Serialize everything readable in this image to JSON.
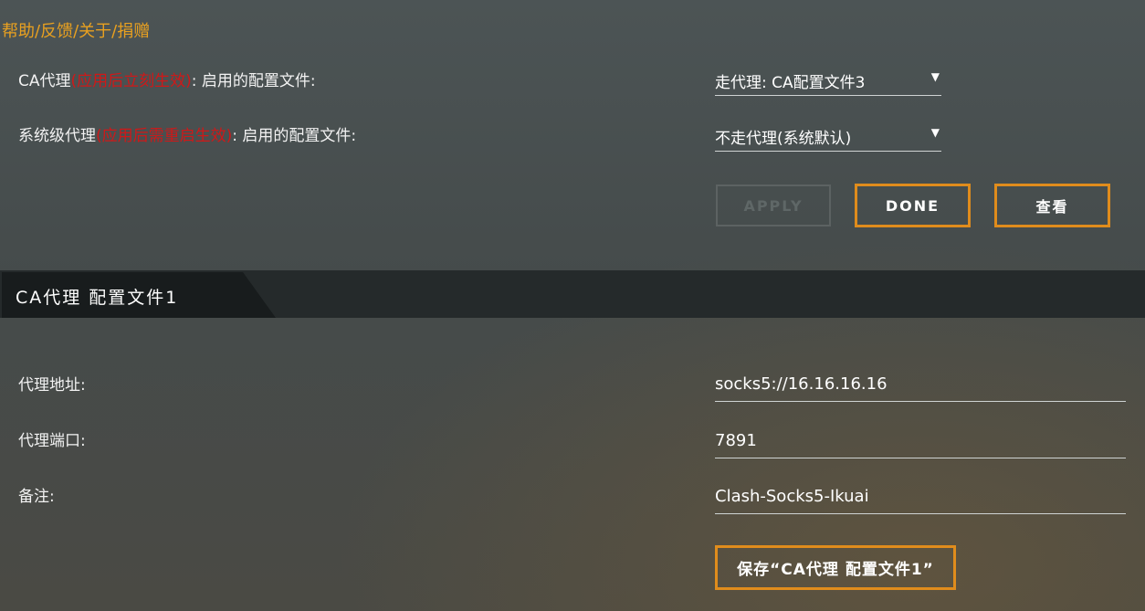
{
  "help_link": "帮助/反馈/关于/捐赠",
  "ca_proxy": {
    "label_main": "CA代理",
    "label_note": "(应用后立刻生效)",
    "label_suffix": ": 启用的配置文件:",
    "selected": "走代理: CA配置文件3"
  },
  "system_proxy": {
    "label_main": "系统级代理",
    "label_note": "(应用后需重启生效)",
    "label_suffix": ": 启用的配置文件:",
    "selected": "不走代理(系统默认)"
  },
  "dropdown_arrow": "▼",
  "buttons": {
    "apply": "APPLY",
    "done": "DONE",
    "view": "查看"
  },
  "section": {
    "title": "CA代理 配置文件1"
  },
  "fields": {
    "address_label": "代理地址:",
    "address_value": "socks5://16.16.16.16",
    "port_label": "代理端口:",
    "port_value": "7891",
    "note_label": "备注:",
    "note_value": "Clash-Socks5-Ikuai"
  },
  "save_button": "保存“CA代理 配置文件1”",
  "colors": {
    "accent": "#e08c1c",
    "help_link": "#e8a020",
    "warning_red": "#d01818"
  }
}
